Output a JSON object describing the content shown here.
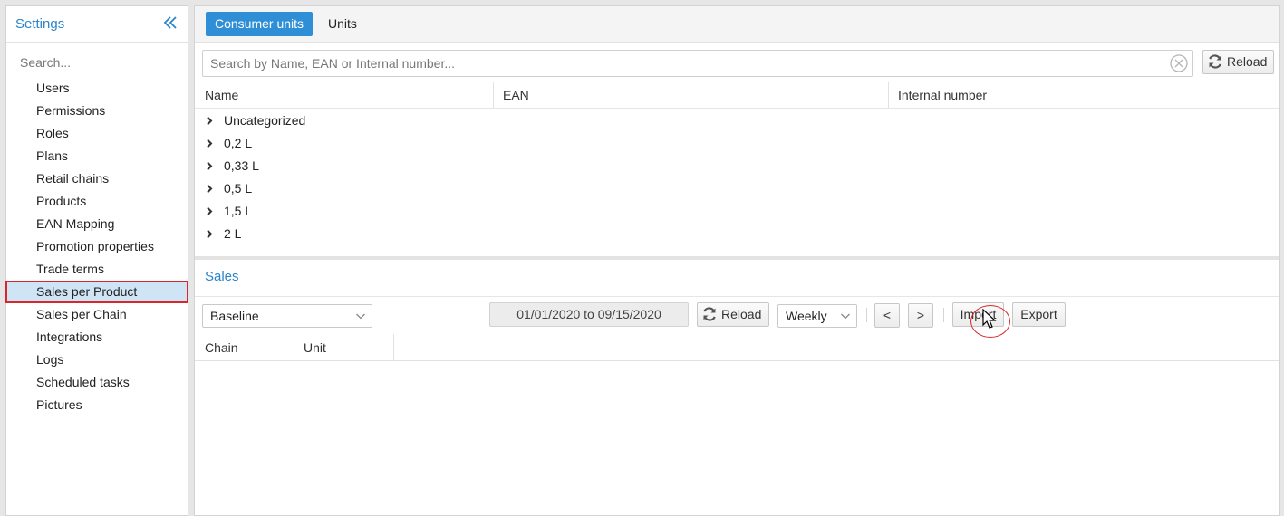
{
  "sidebar": {
    "title": "Settings",
    "search_placeholder": "Search...",
    "items": [
      {
        "label": "Users"
      },
      {
        "label": "Permissions"
      },
      {
        "label": "Roles"
      },
      {
        "label": "Plans"
      },
      {
        "label": "Retail chains"
      },
      {
        "label": "Products"
      },
      {
        "label": "EAN Mapping"
      },
      {
        "label": "Promotion properties"
      },
      {
        "label": "Trade terms"
      },
      {
        "label": "Sales per Product",
        "active": true
      },
      {
        "label": "Sales per Chain"
      },
      {
        "label": "Integrations"
      },
      {
        "label": "Logs"
      },
      {
        "label": "Scheduled tasks"
      },
      {
        "label": "Pictures"
      }
    ]
  },
  "tabs": [
    {
      "label": "Consumer units",
      "active": true
    },
    {
      "label": "Units",
      "active": false
    }
  ],
  "product_search": {
    "placeholder": "Search by Name, EAN or Internal number...",
    "value": "",
    "reload_label": "Reload"
  },
  "product_grid": {
    "columns": [
      "Name",
      "EAN",
      "Internal number"
    ],
    "rows": [
      {
        "label": "Uncategorized"
      },
      {
        "label": "0,2 L"
      },
      {
        "label": "0,33 L"
      },
      {
        "label": "0,5 L"
      },
      {
        "label": "1,5 L"
      },
      {
        "label": "2 L"
      }
    ]
  },
  "sales": {
    "title": "Sales",
    "scenario_select": "Baseline",
    "date_range": "01/01/2020 to 09/15/2020",
    "reload_label": "Reload",
    "period_select": "Weekly",
    "prev_label": "<",
    "next_label": ">",
    "import_label": "Import",
    "export_label": "Export",
    "columns": [
      "Chain",
      "Unit"
    ]
  },
  "colors": {
    "accent": "#2f8fd6",
    "title_blue": "#2b84c9",
    "active_item_bg": "#cfe4f5",
    "highlight_red": "#d9262b"
  }
}
